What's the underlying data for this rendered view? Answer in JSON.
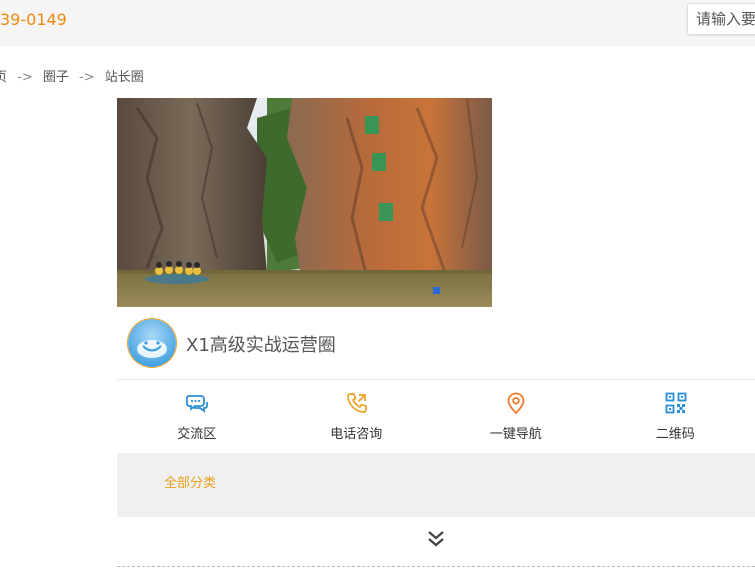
{
  "header": {
    "phone": "39-0149",
    "search_placeholder": "请输入要"
  },
  "breadcrumb": {
    "items": [
      "页",
      "圈子",
      "站长圈"
    ],
    "separator": "->"
  },
  "circle": {
    "title": "X1高级实战运营圈"
  },
  "actions": [
    {
      "label": "交流区",
      "icon": "chat-icon",
      "color": "#2a8fd8"
    },
    {
      "label": "电话咨询",
      "icon": "phone-icon",
      "color": "#f0a020"
    },
    {
      "label": "一键导航",
      "icon": "location-pin-icon",
      "color": "#f07a2a"
    },
    {
      "label": "二维码",
      "icon": "qr-code-icon",
      "color": "#2a8fd8"
    }
  ],
  "categories": {
    "all_label": "全部分类"
  },
  "colors": {
    "accent_orange": "#f0890f",
    "category_text": "#e8a020",
    "category_bg": "#f0f0f0"
  }
}
